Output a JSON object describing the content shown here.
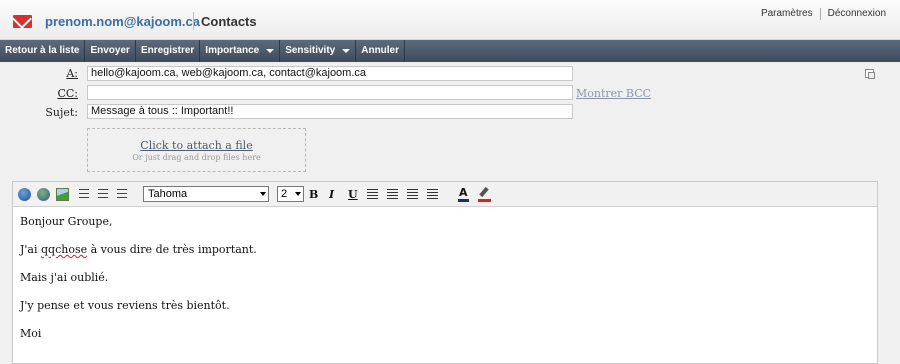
{
  "header": {
    "account": "prenom.nom@kajoom.ca",
    "title": "Contacts",
    "links": [
      "Paramètres",
      "Déconnexion"
    ]
  },
  "toolbar": {
    "back": "Retour à la liste",
    "send": "Envoyer",
    "save": "Enregistrer",
    "importance": "Importance",
    "sensitivity": "Sensitivity",
    "cancel": "Annuler"
  },
  "compose": {
    "to_label": "A:",
    "to_value": "hello@kajoom.ca, web@kajoom.ca, contact@kajoom.ca",
    "cc_label": "CC:",
    "cc_value": "",
    "subject_label": "Sujet:",
    "subject_value": "Message à tous :: Important!!",
    "show_bcc": "Montrer BCC"
  },
  "attachment": {
    "link": "Click to attach a file",
    "hint": "Or just drag and drop files here"
  },
  "editor": {
    "font": "Tahoma",
    "size": "2",
    "bold": "B",
    "italic": "I",
    "underline": "U",
    "font_color_glyph": "A",
    "body": {
      "line1": "Bonjour Groupe,",
      "line2_pre": "J'ai ",
      "line2_misspelled": "qqchose",
      "line2_post": " à vous dire de très important.",
      "line3": "Mais j'ai oublié.",
      "line4": "J'y pense et vous reviens très bientôt.",
      "line5": "Moi"
    }
  },
  "colors": {
    "accent": "#3a6ea5",
    "toolbar_bg": "#4a5668",
    "error_underline": "#d02020"
  }
}
